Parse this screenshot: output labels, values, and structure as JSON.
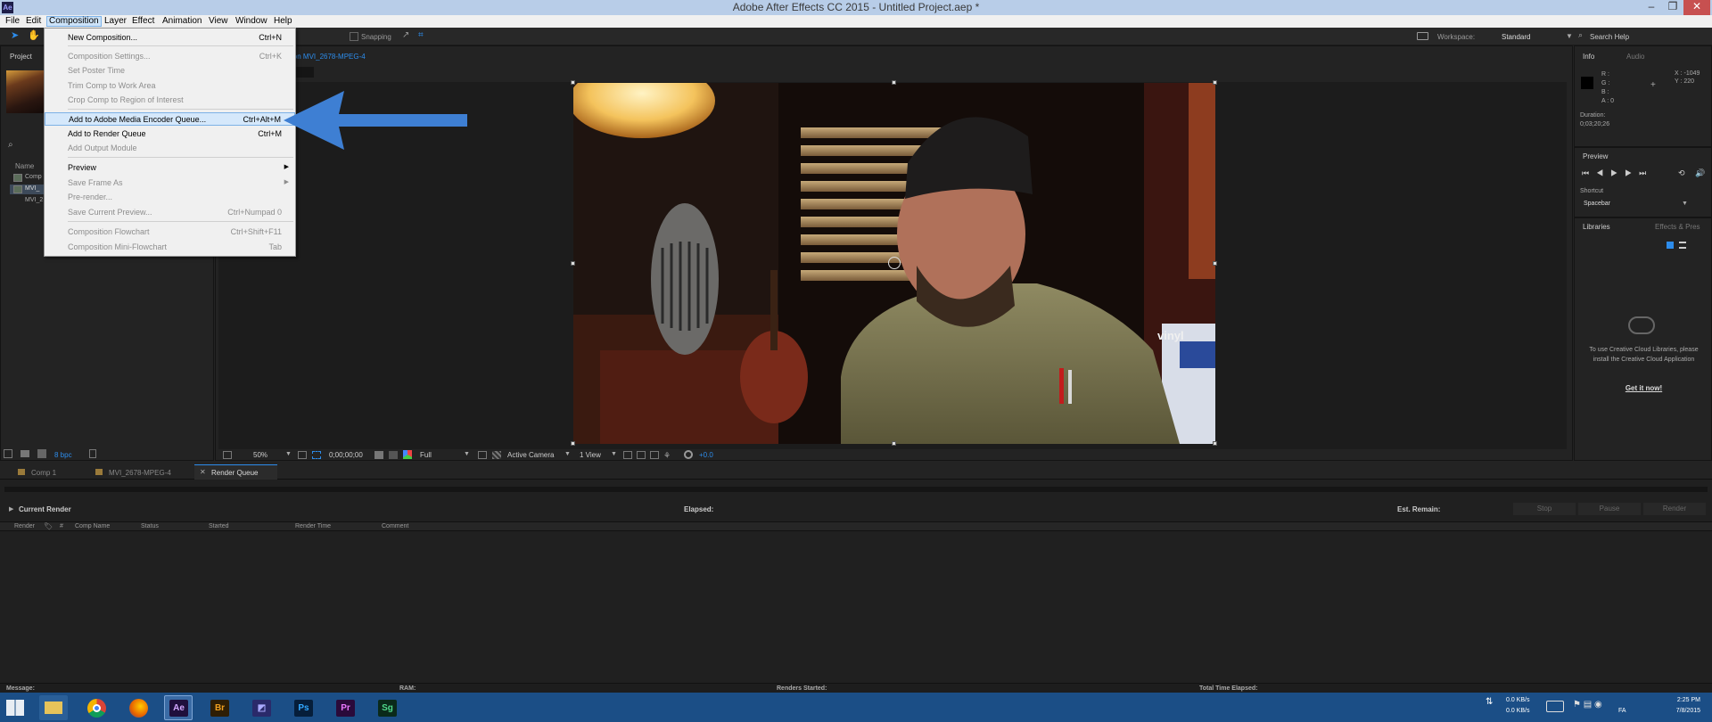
{
  "window": {
    "title": "Adobe After Effects CC 2015 - Untitled Project.aep *",
    "logo": "Ae",
    "minimize": "–",
    "restore": "❐",
    "close": "✕"
  },
  "menubar": {
    "items": [
      "File",
      "Edit",
      "Composition",
      "Layer",
      "Effect",
      "Animation",
      "View",
      "Window",
      "Help"
    ]
  },
  "toolbar": {
    "snapping": "Snapping",
    "workspace_label": "Workspace:",
    "workspace_value": "Standard",
    "search_placeholder": "Search Help"
  },
  "composition_menu": {
    "items": [
      {
        "label": "New Composition...",
        "shortcut": "Ctrl+N",
        "enabled": true
      },
      {
        "label": "Composition Settings...",
        "shortcut": "Ctrl+K",
        "enabled": false
      },
      {
        "label": "Set Poster Time",
        "shortcut": "",
        "enabled": false
      },
      {
        "label": "Trim Comp to Work Area",
        "shortcut": "",
        "enabled": false
      },
      {
        "label": "Crop Comp to Region of Interest",
        "shortcut": "",
        "enabled": false
      },
      {
        "label": "Add to Adobe Media Encoder Queue...",
        "shortcut": "Ctrl+Alt+M",
        "enabled": true
      },
      {
        "label": "Add to Render Queue",
        "shortcut": "Ctrl+M",
        "enabled": true
      },
      {
        "label": "Add Output Module",
        "shortcut": "",
        "enabled": false
      },
      {
        "label": "Preview",
        "shortcut": "",
        "enabled": true,
        "submenu": true
      },
      {
        "label": "Save Frame As",
        "shortcut": "",
        "enabled": false,
        "submenu": true
      },
      {
        "label": "Pre-render...",
        "shortcut": "",
        "enabled": false
      },
      {
        "label": "Save Current Preview...",
        "shortcut": "Ctrl+Numpad 0",
        "enabled": false
      },
      {
        "label": "Composition Flowchart",
        "shortcut": "Ctrl+Shift+F11",
        "enabled": false
      },
      {
        "label": "Composition Mini-Flowchart",
        "shortcut": "Tab",
        "enabled": false
      }
    ]
  },
  "project_panel": {
    "tab": "Project",
    "column_name": "Name",
    "items": [
      "Comp",
      "MVI_",
      "MVI_2"
    ],
    "bpc": "8 bpc"
  },
  "comp_viewer": {
    "tab_suffix": "ion MVI_2678-MPEG-4",
    "zoom": "50%",
    "timecode": "0;00;00;00",
    "resolution": "Full",
    "camera": "Active Camera",
    "views": "1 View",
    "exposure": "+0.0",
    "video_text": "vinyl"
  },
  "info_panel": {
    "tabs": [
      "Info",
      "Audio"
    ],
    "r": "R :",
    "g": "G :",
    "b": "B :",
    "a": "A : 0",
    "x": "X : -1049",
    "y": "Y : 220",
    "duration_label": "Duration:",
    "duration_value": "0;03;20;26"
  },
  "preview_panel": {
    "tab": "Preview",
    "shortcut_label": "Shortcut",
    "shortcut_value": "Spacebar"
  },
  "libraries_panel": {
    "tabs": [
      "Libraries",
      "Effects & Pres"
    ],
    "message": "To use Creative Cloud Libraries, please install the Creative Cloud Application",
    "link": "Get it now!"
  },
  "bottom_tabs": [
    "Comp 1",
    "MVI_2678-MPEG-4",
    "Render Queue"
  ],
  "render_queue": {
    "current_render": "Current Render",
    "elapsed": "Elapsed:",
    "est_remain": "Est. Remain:",
    "buttons": [
      "Stop",
      "Pause",
      "Render"
    ],
    "columns": [
      "Render",
      "#",
      "Comp Name",
      "Status",
      "Started",
      "Render Time",
      "Comment"
    ],
    "footer": {
      "message": "Message:",
      "ram": "RAM:",
      "renders_started": "Renders Started:",
      "total_time": "Total Time Elapsed:"
    }
  },
  "taskbar": {
    "apps": [
      "Ae",
      "Br",
      "Ps",
      "Pr",
      "Sg"
    ],
    "net_up": "0.0 KB/s",
    "net_down": "0.0 KB/s",
    "lang": "FA",
    "time": "2:25 PM",
    "date": "7/8/2015"
  },
  "colors": {
    "arrow": "#3e7fd3",
    "accent_blue": "#2d8ceb",
    "taskbar": "#1b4e86",
    "titlebar": "#b8cde8"
  }
}
